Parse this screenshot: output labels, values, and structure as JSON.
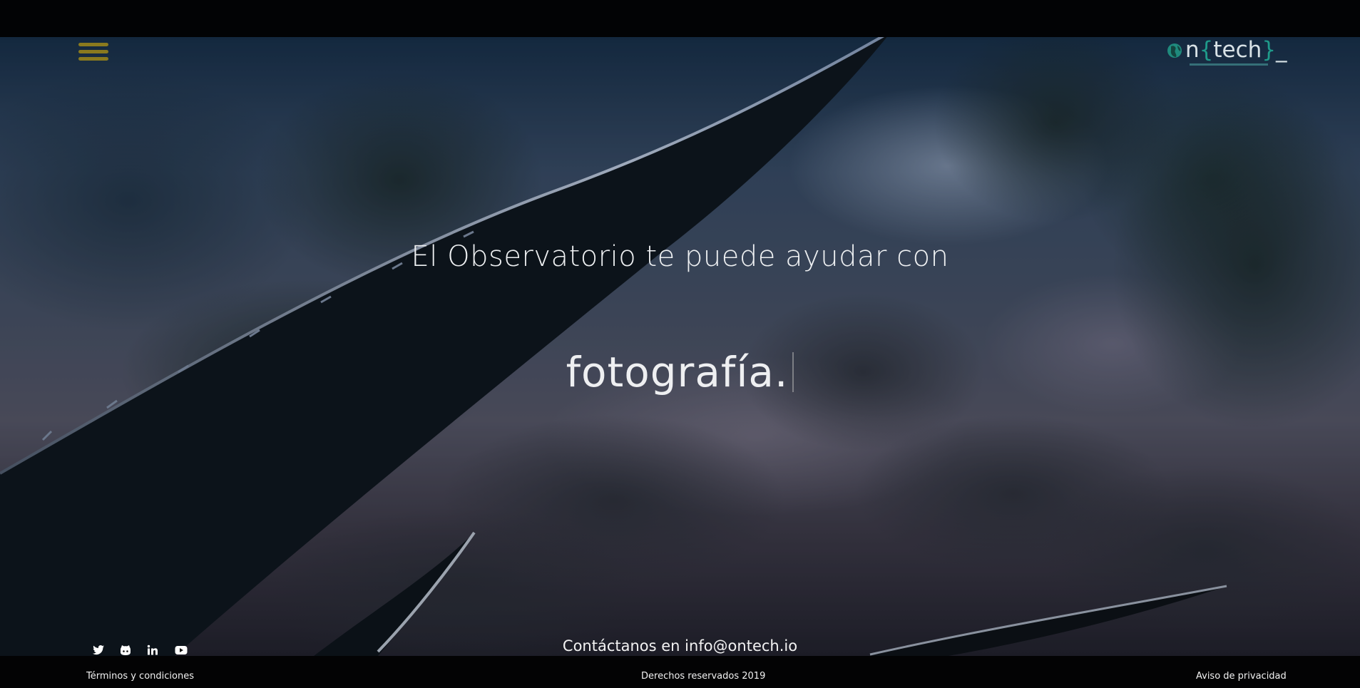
{
  "header": {
    "menu_icon": "hamburger-menu-icon",
    "logo": {
      "letter_n": "n",
      "brace_open": "{",
      "word": "tech",
      "brace_close": "}",
      "cursor": "_",
      "globe_icon": "globe-icon"
    }
  },
  "hero": {
    "headline": "El Observatorio te puede ayudar con",
    "rotating_word": "fotografía."
  },
  "contact": {
    "prefix": "Contáctanos en ",
    "email": "info@ontech.io"
  },
  "social": [
    {
      "icon": "twitter-icon"
    },
    {
      "icon": "github-icon"
    },
    {
      "icon": "linkedin-icon"
    },
    {
      "icon": "youtube-icon"
    }
  ],
  "footer": {
    "terms": "Términos y condiciones",
    "rights": "Derechos reservados 2019",
    "privacy": "Aviso de privacidad"
  },
  "colors": {
    "menu_icon": "#8a7a1e",
    "logo_accent": "#1f9a8a",
    "text": "#eef0f2",
    "footer_bg": "#030304"
  }
}
